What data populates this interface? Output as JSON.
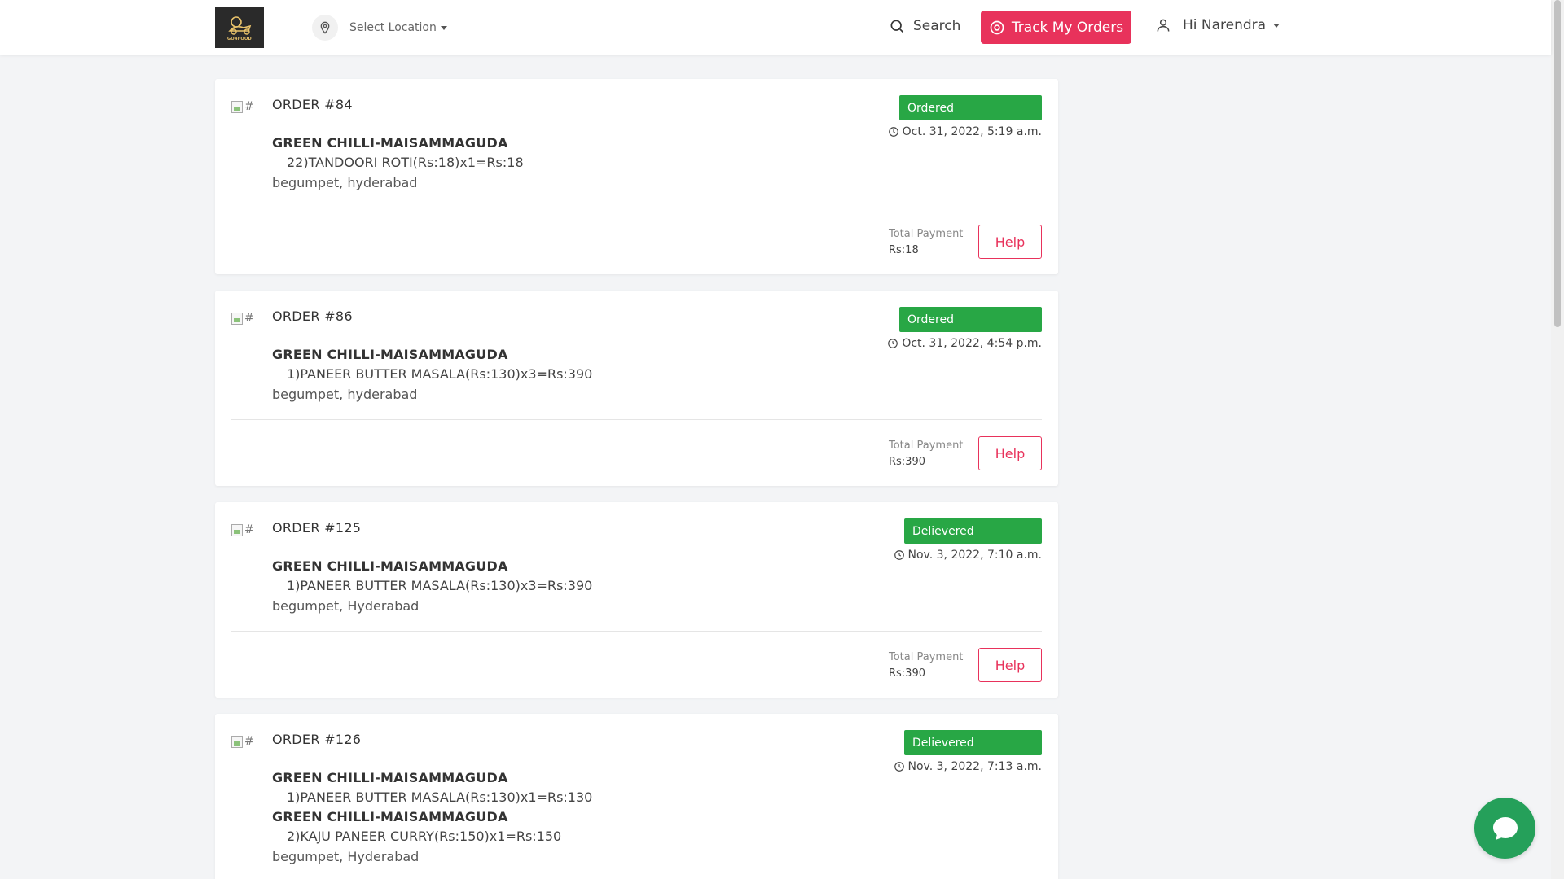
{
  "header": {
    "logo_text": "GO4FOOD",
    "location_label": "Select Location",
    "search_label": "Search",
    "track_label": "Track My Orders",
    "user_label": "Hi Narendra"
  },
  "orders": [
    {
      "order_no": "ORDER #84",
      "thumb_alt": "#",
      "lines": [
        {
          "restaurant": "GREEN CHILLI-MAISAMMAGUDA",
          "item": "22)TANDOORI ROTI(Rs:18)x1=Rs:18"
        }
      ],
      "address": "begumpet, hyderabad",
      "status": "Ordered",
      "date": "Oct. 31, 2022, 5:19 a.m.",
      "payment_label": "Total Payment",
      "payment_value": "Rs:18",
      "help_label": "Help"
    },
    {
      "order_no": "ORDER #86",
      "thumb_alt": "#",
      "lines": [
        {
          "restaurant": "GREEN CHILLI-MAISAMMAGUDA",
          "item": "1)PANEER BUTTER MASALA(Rs:130)x3=Rs:390"
        }
      ],
      "address": "begumpet, hyderabad",
      "status": "Ordered",
      "date": "Oct. 31, 2022, 4:54 p.m.",
      "payment_label": "Total Payment",
      "payment_value": "Rs:390",
      "help_label": "Help"
    },
    {
      "order_no": "ORDER #125",
      "thumb_alt": "#",
      "lines": [
        {
          "restaurant": "GREEN CHILLI-MAISAMMAGUDA",
          "item": "1)PANEER BUTTER MASALA(Rs:130)x3=Rs:390"
        }
      ],
      "address": "begumpet, Hyderabad",
      "status": "Delievered",
      "date": "Nov. 3, 2022, 7:10 a.m.",
      "payment_label": "Total Payment",
      "payment_value": "Rs:390",
      "help_label": "Help"
    },
    {
      "order_no": "ORDER #126",
      "thumb_alt": "#",
      "lines": [
        {
          "restaurant": "GREEN CHILLI-MAISAMMAGUDA",
          "item": "1)PANEER BUTTER MASALA(Rs:130)x1=Rs:130"
        },
        {
          "restaurant": "GREEN CHILLI-MAISAMMAGUDA",
          "item": "2)KAJU PANEER CURRY(Rs:150)x1=Rs:150"
        }
      ],
      "address": "begumpet, Hyderabad",
      "status": "Delievered",
      "date": "Nov. 3, 2022, 7:13 a.m.",
      "payment_label": "",
      "payment_value": "",
      "help_label": ""
    }
  ],
  "colors": {
    "accent": "#e8325b",
    "status_green": "#28a745",
    "chat_green": "#25a05a"
  },
  "icons": {
    "location": "map-pin-icon",
    "search": "search-icon",
    "track": "target-icon",
    "user": "user-icon",
    "clock": "clock-icon",
    "chat": "chat-bubble-icon"
  }
}
